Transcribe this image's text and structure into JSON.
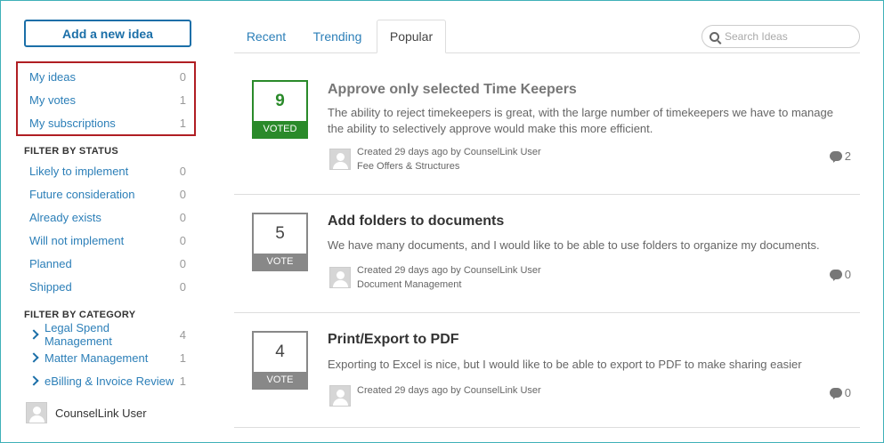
{
  "sidebar": {
    "add_button": "Add a new idea",
    "my_items": [
      {
        "label": "My ideas",
        "count": "0"
      },
      {
        "label": "My votes",
        "count": "1"
      },
      {
        "label": "My subscriptions",
        "count": "1"
      }
    ],
    "status_heading": "FILTER BY STATUS",
    "status_items": [
      {
        "label": "Likely to implement",
        "count": "0"
      },
      {
        "label": "Future consideration",
        "count": "0"
      },
      {
        "label": "Already exists",
        "count": "0"
      },
      {
        "label": "Will not implement",
        "count": "0"
      },
      {
        "label": "Planned",
        "count": "0"
      },
      {
        "label": "Shipped",
        "count": "0"
      }
    ],
    "category_heading": "FILTER BY CATEGORY",
    "category_items": [
      {
        "label": "Legal Spend Management",
        "count": "4"
      },
      {
        "label": "Matter Management",
        "count": "1"
      },
      {
        "label": "eBilling & Invoice Review",
        "count": "1"
      }
    ],
    "user_name": "CounselLink User"
  },
  "tabs": [
    {
      "label": "Recent",
      "active": false
    },
    {
      "label": "Trending",
      "active": false
    },
    {
      "label": "Popular",
      "active": true
    }
  ],
  "search": {
    "placeholder": "Search Ideas",
    "value": ""
  },
  "ideas": [
    {
      "votes": "9",
      "vote_label": "VOTED",
      "voted": true,
      "title": "Approve only selected Time Keepers",
      "description": "The ability to reject timekeepers is great, with the large number of timekeepers we have to manage the ability to selectively approve would make this more efficient.",
      "created": "Created 29 days ago by CounselLink User",
      "category": "Fee Offers & Structures",
      "comments": "2"
    },
    {
      "votes": "5",
      "vote_label": "VOTE",
      "voted": false,
      "title": "Add folders to documents",
      "description": "We have many documents, and I would like to be able to use folders to organize my documents.",
      "created": "Created 29 days ago by CounselLink User",
      "category": "Document Management",
      "comments": "0"
    },
    {
      "votes": "4",
      "vote_label": "VOTE",
      "voted": false,
      "title": "Print/Export to PDF",
      "description": "Exporting to Excel is nice, but I would like to be able to export to PDF to make sharing easier",
      "created": "Created 29 days ago by CounselLink User",
      "category": "",
      "comments": "0"
    }
  ],
  "colors": {
    "link": "#2c7fb8",
    "button_border": "#1b6fa8",
    "highlight_box": "#b01e23",
    "voted_green": "#2a8a2a",
    "vote_gray": "#888888",
    "frame": "#3fb1b8"
  }
}
